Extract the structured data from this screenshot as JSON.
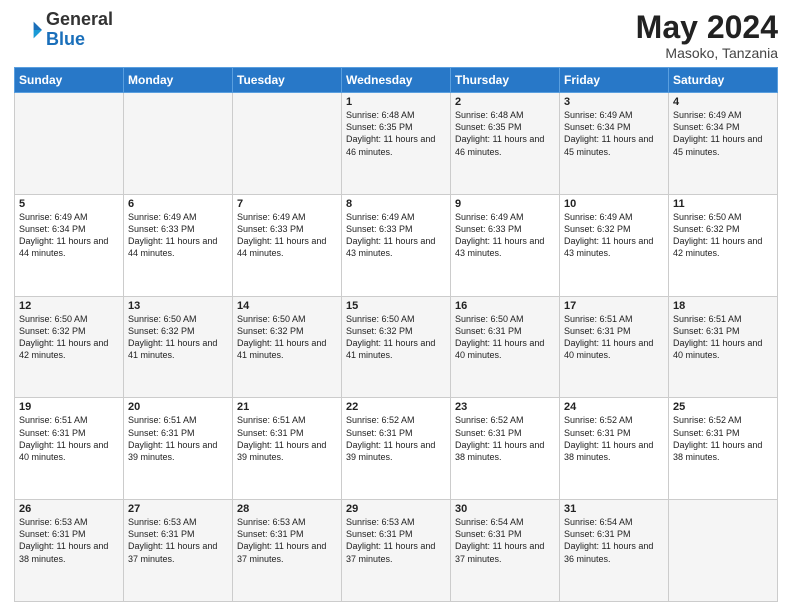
{
  "header": {
    "logo_general": "General",
    "logo_blue": "Blue",
    "month_year": "May 2024",
    "location": "Masoko, Tanzania"
  },
  "days_of_week": [
    "Sunday",
    "Monday",
    "Tuesday",
    "Wednesday",
    "Thursday",
    "Friday",
    "Saturday"
  ],
  "weeks": [
    [
      {
        "day": "",
        "content": ""
      },
      {
        "day": "",
        "content": ""
      },
      {
        "day": "",
        "content": ""
      },
      {
        "day": "1",
        "content": "Sunrise: 6:48 AM\nSunset: 6:35 PM\nDaylight: 11 hours and 46 minutes."
      },
      {
        "day": "2",
        "content": "Sunrise: 6:48 AM\nSunset: 6:35 PM\nDaylight: 11 hours and 46 minutes."
      },
      {
        "day": "3",
        "content": "Sunrise: 6:49 AM\nSunset: 6:34 PM\nDaylight: 11 hours and 45 minutes."
      },
      {
        "day": "4",
        "content": "Sunrise: 6:49 AM\nSunset: 6:34 PM\nDaylight: 11 hours and 45 minutes."
      }
    ],
    [
      {
        "day": "5",
        "content": "Sunrise: 6:49 AM\nSunset: 6:34 PM\nDaylight: 11 hours and 44 minutes."
      },
      {
        "day": "6",
        "content": "Sunrise: 6:49 AM\nSunset: 6:33 PM\nDaylight: 11 hours and 44 minutes."
      },
      {
        "day": "7",
        "content": "Sunrise: 6:49 AM\nSunset: 6:33 PM\nDaylight: 11 hours and 44 minutes."
      },
      {
        "day": "8",
        "content": "Sunrise: 6:49 AM\nSunset: 6:33 PM\nDaylight: 11 hours and 43 minutes."
      },
      {
        "day": "9",
        "content": "Sunrise: 6:49 AM\nSunset: 6:33 PM\nDaylight: 11 hours and 43 minutes."
      },
      {
        "day": "10",
        "content": "Sunrise: 6:49 AM\nSunset: 6:32 PM\nDaylight: 11 hours and 43 minutes."
      },
      {
        "day": "11",
        "content": "Sunrise: 6:50 AM\nSunset: 6:32 PM\nDaylight: 11 hours and 42 minutes."
      }
    ],
    [
      {
        "day": "12",
        "content": "Sunrise: 6:50 AM\nSunset: 6:32 PM\nDaylight: 11 hours and 42 minutes."
      },
      {
        "day": "13",
        "content": "Sunrise: 6:50 AM\nSunset: 6:32 PM\nDaylight: 11 hours and 41 minutes."
      },
      {
        "day": "14",
        "content": "Sunrise: 6:50 AM\nSunset: 6:32 PM\nDaylight: 11 hours and 41 minutes."
      },
      {
        "day": "15",
        "content": "Sunrise: 6:50 AM\nSunset: 6:32 PM\nDaylight: 11 hours and 41 minutes."
      },
      {
        "day": "16",
        "content": "Sunrise: 6:50 AM\nSunset: 6:31 PM\nDaylight: 11 hours and 40 minutes."
      },
      {
        "day": "17",
        "content": "Sunrise: 6:51 AM\nSunset: 6:31 PM\nDaylight: 11 hours and 40 minutes."
      },
      {
        "day": "18",
        "content": "Sunrise: 6:51 AM\nSunset: 6:31 PM\nDaylight: 11 hours and 40 minutes."
      }
    ],
    [
      {
        "day": "19",
        "content": "Sunrise: 6:51 AM\nSunset: 6:31 PM\nDaylight: 11 hours and 40 minutes."
      },
      {
        "day": "20",
        "content": "Sunrise: 6:51 AM\nSunset: 6:31 PM\nDaylight: 11 hours and 39 minutes."
      },
      {
        "day": "21",
        "content": "Sunrise: 6:51 AM\nSunset: 6:31 PM\nDaylight: 11 hours and 39 minutes."
      },
      {
        "day": "22",
        "content": "Sunrise: 6:52 AM\nSunset: 6:31 PM\nDaylight: 11 hours and 39 minutes."
      },
      {
        "day": "23",
        "content": "Sunrise: 6:52 AM\nSunset: 6:31 PM\nDaylight: 11 hours and 38 minutes."
      },
      {
        "day": "24",
        "content": "Sunrise: 6:52 AM\nSunset: 6:31 PM\nDaylight: 11 hours and 38 minutes."
      },
      {
        "day": "25",
        "content": "Sunrise: 6:52 AM\nSunset: 6:31 PM\nDaylight: 11 hours and 38 minutes."
      }
    ],
    [
      {
        "day": "26",
        "content": "Sunrise: 6:53 AM\nSunset: 6:31 PM\nDaylight: 11 hours and 38 minutes."
      },
      {
        "day": "27",
        "content": "Sunrise: 6:53 AM\nSunset: 6:31 PM\nDaylight: 11 hours and 37 minutes."
      },
      {
        "day": "28",
        "content": "Sunrise: 6:53 AM\nSunset: 6:31 PM\nDaylight: 11 hours and 37 minutes."
      },
      {
        "day": "29",
        "content": "Sunrise: 6:53 AM\nSunset: 6:31 PM\nDaylight: 11 hours and 37 minutes."
      },
      {
        "day": "30",
        "content": "Sunrise: 6:54 AM\nSunset: 6:31 PM\nDaylight: 11 hours and 37 minutes."
      },
      {
        "day": "31",
        "content": "Sunrise: 6:54 AM\nSunset: 6:31 PM\nDaylight: 11 hours and 36 minutes."
      },
      {
        "day": "",
        "content": ""
      }
    ]
  ]
}
